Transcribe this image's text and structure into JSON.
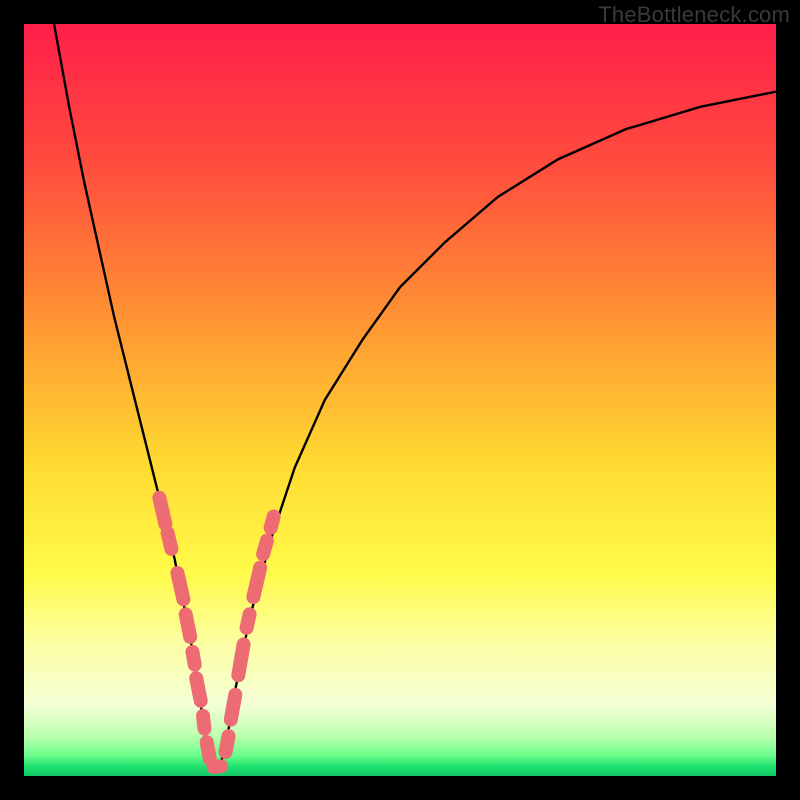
{
  "watermark": "TheBottleneck.com",
  "gradient": {
    "stops": [
      {
        "offset": 0.0,
        "color": "#ff1f4a"
      },
      {
        "offset": 0.18,
        "color": "#ff4a3e"
      },
      {
        "offset": 0.38,
        "color": "#ff8f33"
      },
      {
        "offset": 0.58,
        "color": "#ffd931"
      },
      {
        "offset": 0.73,
        "color": "#fffb4a"
      },
      {
        "offset": 0.83,
        "color": "#fcffa8"
      },
      {
        "offset": 0.905,
        "color": "#f4ffd6"
      },
      {
        "offset": 0.945,
        "color": "#bfffb0"
      },
      {
        "offset": 0.972,
        "color": "#6dff8c"
      },
      {
        "offset": 0.988,
        "color": "#1fe06f"
      },
      {
        "offset": 1.0,
        "color": "#14c767"
      }
    ]
  },
  "chart_data": {
    "type": "line",
    "title": "",
    "xlabel": "",
    "ylabel": "",
    "xlim": [
      0,
      100
    ],
    "ylim": [
      0,
      100
    ],
    "grid": false,
    "note": "Axes are in percent of plot area (0–100 on each axis). y=0 is at the bottom (green) and y=100 at the top (red). The black curve is a V-shaped bottleneck line whose minimum near x≈25 touches y≈0. Overlay markers (salmon capsules) lie on both branches near the minimum.",
    "series": [
      {
        "name": "bottleneck-curve",
        "color": "#000000",
        "x": [
          4,
          6,
          8,
          10,
          12,
          14,
          16,
          18,
          20,
          22,
          23,
          24,
          25,
          26,
          27,
          28,
          30,
          33,
          36,
          40,
          45,
          50,
          56,
          63,
          71,
          80,
          90,
          100
        ],
        "y": [
          100,
          89,
          79,
          70,
          61,
          53,
          45,
          37,
          29,
          19,
          13,
          6,
          1,
          1,
          5,
          11,
          21,
          32,
          41,
          50,
          58,
          65,
          71,
          77,
          82,
          86,
          89,
          91
        ]
      }
    ],
    "overlay_markers": {
      "name": "highlighted-segment",
      "color": "#ed6b73",
      "note": "each item is a short rounded capsule segment from (x1,y1) to (x2,y2) in percent units",
      "segments": [
        {
          "x1": 18.0,
          "y1": 37.0,
          "x2": 18.8,
          "y2": 33.5
        },
        {
          "x1": 19.1,
          "y1": 32.3,
          "x2": 19.6,
          "y2": 30.2
        },
        {
          "x1": 20.4,
          "y1": 27.0,
          "x2": 21.2,
          "y2": 23.5
        },
        {
          "x1": 21.5,
          "y1": 21.5,
          "x2": 22.1,
          "y2": 18.5
        },
        {
          "x1": 22.4,
          "y1": 16.5,
          "x2": 22.7,
          "y2": 14.8
        },
        {
          "x1": 22.9,
          "y1": 13.0,
          "x2": 23.5,
          "y2": 10.0
        },
        {
          "x1": 23.8,
          "y1": 8.0,
          "x2": 24.0,
          "y2": 6.3
        },
        {
          "x1": 24.3,
          "y1": 4.5,
          "x2": 24.7,
          "y2": 2.3
        },
        {
          "x1": 25.2,
          "y1": 1.2,
          "x2": 26.2,
          "y2": 1.3
        },
        {
          "x1": 26.8,
          "y1": 3.2,
          "x2": 27.2,
          "y2": 5.3
        },
        {
          "x1": 27.5,
          "y1": 7.5,
          "x2": 28.1,
          "y2": 10.8
        },
        {
          "x1": 28.5,
          "y1": 13.4,
          "x2": 29.2,
          "y2": 17.5
        },
        {
          "x1": 29.6,
          "y1": 19.7,
          "x2": 30.0,
          "y2": 21.5
        },
        {
          "x1": 30.5,
          "y1": 23.8,
          "x2": 31.4,
          "y2": 27.7
        },
        {
          "x1": 31.8,
          "y1": 29.5,
          "x2": 32.3,
          "y2": 31.3
        },
        {
          "x1": 32.8,
          "y1": 33.0,
          "x2": 33.2,
          "y2": 34.5
        }
      ]
    }
  }
}
